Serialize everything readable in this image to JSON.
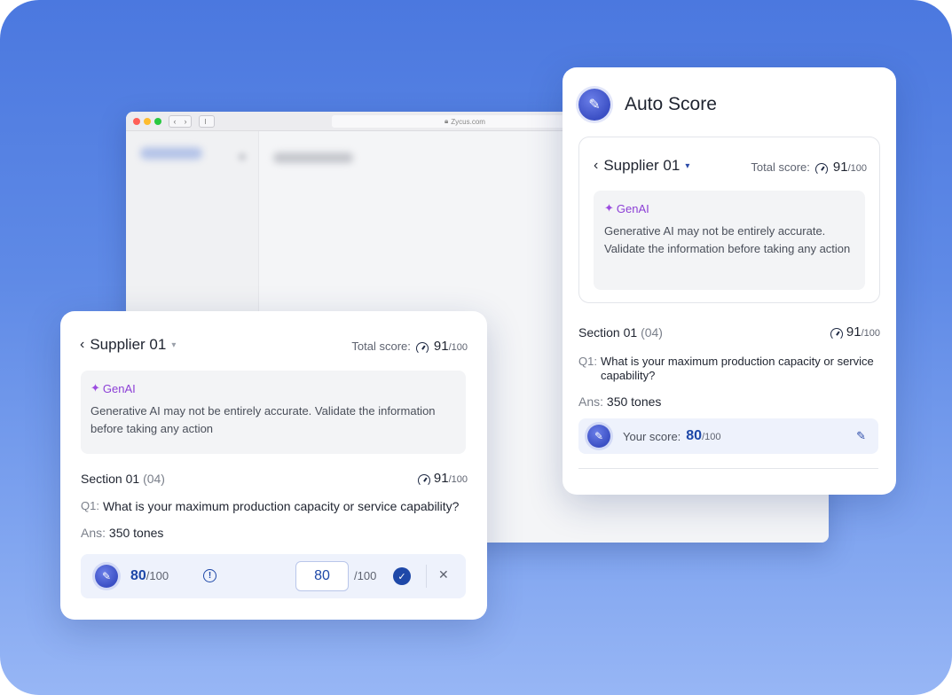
{
  "browser": {
    "url": "Zycus.com",
    "nav_back": "‹",
    "nav_forward": "›"
  },
  "auto_score_panel": {
    "title": "Auto Score",
    "badge_icon": "✎",
    "supplier": {
      "name": "Supplier 01",
      "back_icon": "‹",
      "caret": "▾"
    },
    "total_score": {
      "label": "Total score:",
      "value": "91",
      "max": "/100"
    },
    "genai": {
      "label": "GenAI",
      "icon": "✦",
      "message": "Generative AI may not be entirely accurate. Validate the information before taking any action"
    },
    "section": {
      "label": "Section 01",
      "count": "(04)",
      "score": "91",
      "max": "/100"
    },
    "question": {
      "prefix": "Q1:",
      "text": "What is your maximum production capacity or service capability?"
    },
    "answer": {
      "prefix": "Ans:",
      "text": "350 tones"
    },
    "your_score": {
      "label": "Your score:",
      "value": "80",
      "max": "/100",
      "edit_icon": "✎"
    }
  },
  "edit_panel": {
    "supplier": {
      "name": "Supplier 01",
      "back_icon": "‹",
      "caret": "▾"
    },
    "total_score": {
      "label": "Total score:",
      "value": "91",
      "max": "/100"
    },
    "genai": {
      "label": "GenAI",
      "icon": "✦",
      "message": "Generative AI may not be entirely accurate. Validate the information before taking any action"
    },
    "section": {
      "label": "Section 01",
      "count": "(04)",
      "score": "91",
      "max": "/100"
    },
    "question": {
      "prefix": "Q1:",
      "text": "What is your maximum production capacity or service capability?"
    },
    "answer": {
      "prefix": "Ans:",
      "text": "350 tones"
    },
    "score_editor": {
      "ai_score": "80",
      "ai_max": "/100",
      "info_icon": "!",
      "input_value": "80",
      "input_max": "/100",
      "confirm_icon": "✓",
      "cancel_icon": "✕"
    }
  },
  "colors": {
    "accent": "#1e48a8",
    "genai": "#8c3fd6",
    "background_top": "#4b78df",
    "background_bottom": "#97b6f5"
  }
}
